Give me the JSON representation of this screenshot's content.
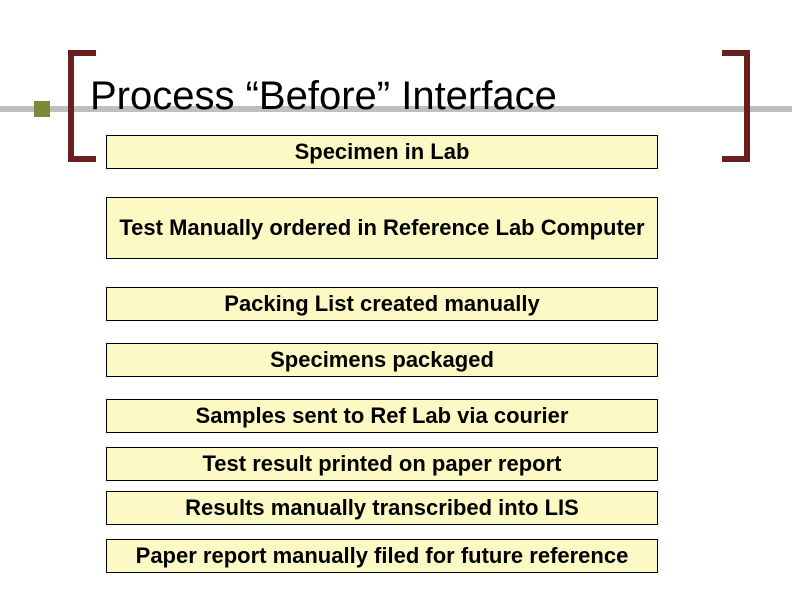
{
  "title": "Process “Before” Interface",
  "colors": {
    "bracket": "#6b1e1e",
    "accent": "#7a8a3a",
    "box_fill": "#fdf9c4",
    "rule": "#bfbfbf"
  },
  "steps": [
    {
      "label": "Specimen in Lab"
    },
    {
      "label": "Test Manually ordered in Reference Lab Computer"
    },
    {
      "label": "Packing List created manually"
    },
    {
      "label": "Specimens packaged"
    },
    {
      "label": "Samples sent to Ref Lab via courier"
    },
    {
      "label": "Test result printed on paper report"
    },
    {
      "label": "Results manually transcribed into LIS"
    },
    {
      "label": "Paper report manually filed for future reference"
    }
  ]
}
